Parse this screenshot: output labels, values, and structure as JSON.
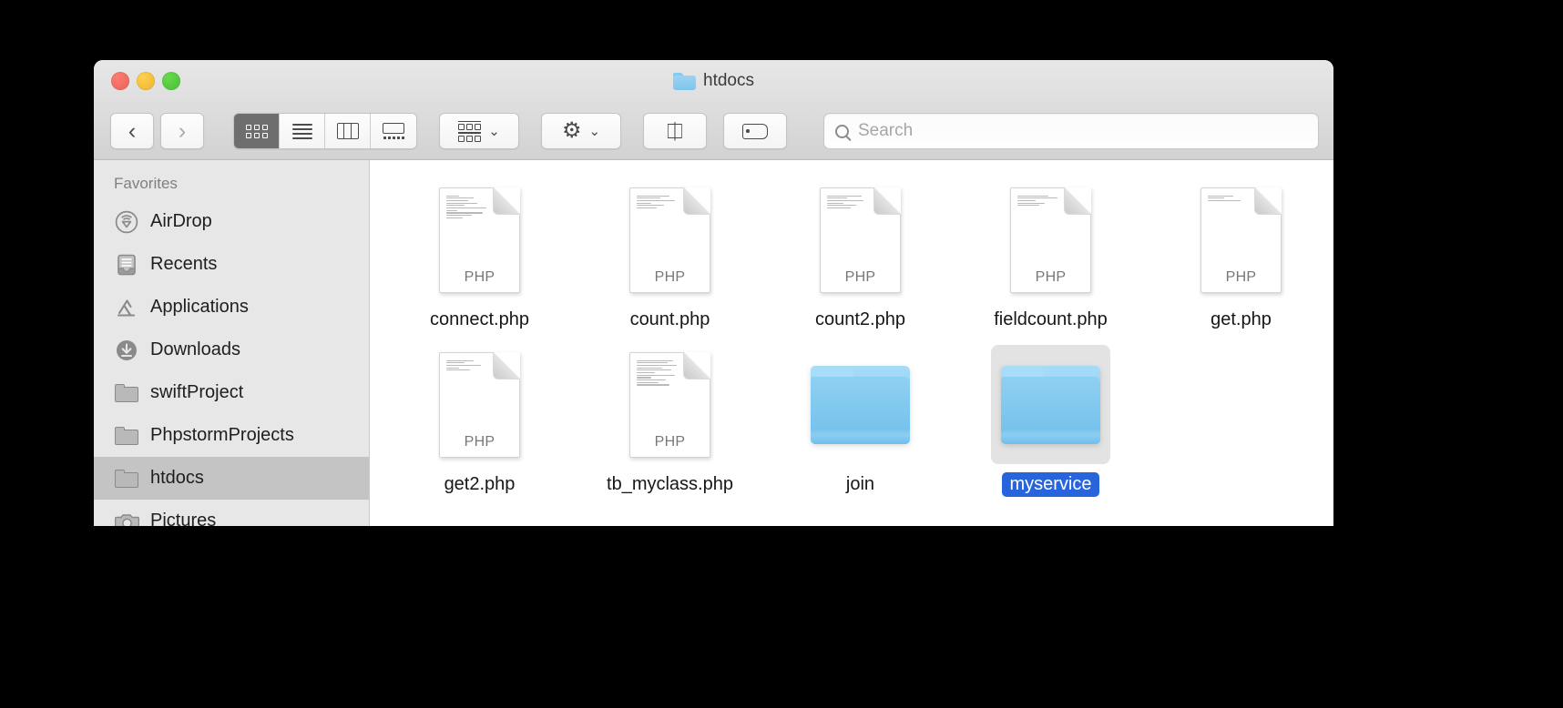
{
  "window": {
    "title": "htdocs",
    "title_icon": "folder-icon",
    "traffic_lights": [
      {
        "name": "close",
        "color": "#e8615a"
      },
      {
        "name": "minimize",
        "color": "#e9b42c"
      },
      {
        "name": "maximize",
        "color": "#46bf36"
      }
    ]
  },
  "toolbar": {
    "back_label": "‹",
    "forward_label": "›",
    "view_modes": [
      {
        "name": "icon-view",
        "icon": "grid-icon",
        "selected": true
      },
      {
        "name": "list-view",
        "icon": "list-icon",
        "selected": false
      },
      {
        "name": "column-view",
        "icon": "columns-icon",
        "selected": false
      },
      {
        "name": "gallery-view",
        "icon": "gallery-icon",
        "selected": false
      }
    ],
    "arrange_icon": "arrange-icon",
    "action_icon": "gear-icon",
    "share_icon": "share-icon",
    "tag_icon": "tag-icon",
    "caret": "⌄"
  },
  "search": {
    "placeholder": "Search",
    "value": "",
    "icon": "search-icon"
  },
  "sidebar": {
    "section_title": "Favorites",
    "items": [
      {
        "label": "AirDrop",
        "icon": "airdrop-icon",
        "selected": false
      },
      {
        "label": "Recents",
        "icon": "recents-icon",
        "selected": false
      },
      {
        "label": "Applications",
        "icon": "applications-icon",
        "selected": false
      },
      {
        "label": "Downloads",
        "icon": "downloads-icon",
        "selected": false
      },
      {
        "label": "swiftProject",
        "icon": "folder-icon",
        "selected": false
      },
      {
        "label": "PhpstormProjects",
        "icon": "folder-icon",
        "selected": false
      },
      {
        "label": "htdocs",
        "icon": "folder-icon",
        "selected": true
      },
      {
        "label": "Pictures",
        "icon": "pictures-icon",
        "selected": false
      }
    ]
  },
  "main": {
    "items": [
      {
        "name": "connect.php",
        "type": "file",
        "kind": "PHP",
        "selected": false
      },
      {
        "name": "count.php",
        "type": "file",
        "kind": "PHP",
        "selected": false
      },
      {
        "name": "count2.php",
        "type": "file",
        "kind": "PHP",
        "selected": false
      },
      {
        "name": "fieldcount.php",
        "type": "file",
        "kind": "PHP",
        "selected": false
      },
      {
        "name": "get.php",
        "type": "file",
        "kind": "PHP",
        "selected": false
      },
      {
        "name": "get2.php",
        "type": "file",
        "kind": "PHP",
        "selected": false
      },
      {
        "name": "tb_myclass.php",
        "type": "file",
        "kind": "PHP",
        "selected": false
      },
      {
        "name": "join",
        "type": "folder",
        "kind": "",
        "selected": false
      },
      {
        "name": "myservice",
        "type": "folder",
        "kind": "",
        "selected": true
      }
    ]
  },
  "colors": {
    "selection_blue": "#2864dc",
    "folder_blue": "#8cceef",
    "sidebar_bg": "#e7e7e7",
    "titlebar_bg": "#dcdcdc"
  }
}
